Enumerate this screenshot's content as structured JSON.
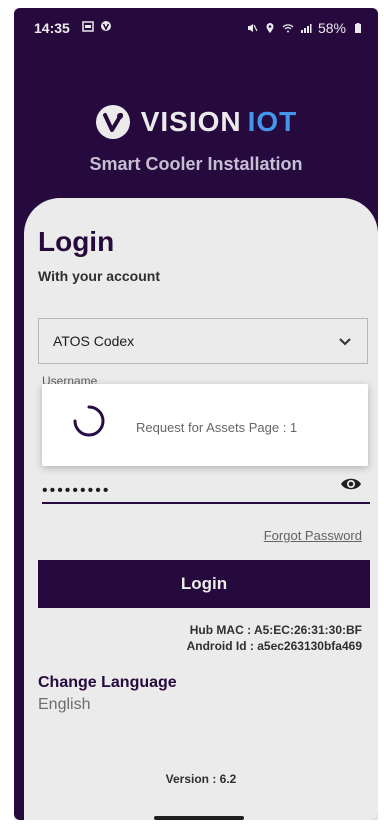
{
  "status_bar": {
    "time": "14:35",
    "battery": "58%"
  },
  "branding": {
    "name_part1": "VISION",
    "name_part2": "IOT",
    "subtitle": "Smart Cooler Installation",
    "accent_color": "#4aa3ff",
    "brand_color": "#2a0b44"
  },
  "login_form": {
    "title": "Login",
    "subtitle": "With your account",
    "client_dropdown": {
      "value": "ATOS Codex"
    },
    "username_label": "Username",
    "password_value": "•••••••••",
    "forgot_password": "Forgot Password",
    "login_button": "Login"
  },
  "device_info": {
    "hub_mac": "Hub MAC : A5:EC:26:31:30:BF",
    "android_id": "Android Id : a5ec263130bfa469"
  },
  "language": {
    "label": "Change Language",
    "value": "English"
  },
  "version": "Version : 6.2",
  "dialog": {
    "message": "Request for Assets Page : 1"
  }
}
